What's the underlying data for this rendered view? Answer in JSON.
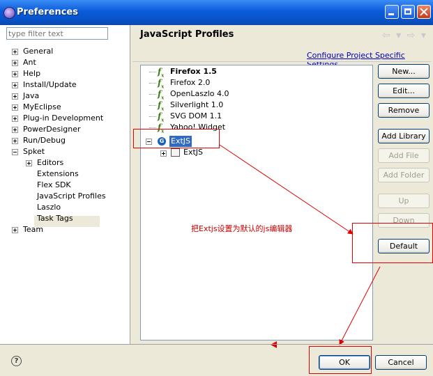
{
  "window": {
    "title": "Preferences"
  },
  "filter": {
    "placeholder": "type filter text"
  },
  "nav": {
    "items": [
      {
        "label": "General"
      },
      {
        "label": "Ant"
      },
      {
        "label": "Help"
      },
      {
        "label": "Install/Update"
      },
      {
        "label": "Java"
      },
      {
        "label": "MyEclipse"
      },
      {
        "label": "Plug-in Development"
      },
      {
        "label": "PowerDesigner"
      },
      {
        "label": "Run/Debug"
      },
      {
        "label": "Spket"
      },
      {
        "label": "Editors"
      },
      {
        "label": "Extensions"
      },
      {
        "label": "Flex SDK"
      },
      {
        "label": "JavaScript Profiles"
      },
      {
        "label": "Laszlo"
      },
      {
        "label": "Task Tags"
      },
      {
        "label": "Team"
      }
    ]
  },
  "page": {
    "title": "JavaScript Profiles",
    "config_link": "Configure Project Specific Settings..."
  },
  "profiles": [
    {
      "label": "Firefox 1.5"
    },
    {
      "label": "Firefox 2.0"
    },
    {
      "label": "OpenLaszlo 4.0"
    },
    {
      "label": "Silverlight 1.0"
    },
    {
      "label": "SVG DOM 1.1"
    },
    {
      "label": "Yahoo! Widget"
    },
    {
      "label": "ExtJS"
    },
    {
      "label": "ExtJS"
    }
  ],
  "buttons": {
    "new": "New...",
    "edit": "Edit...",
    "remove": "Remove",
    "add_library": "Add Library",
    "add_file": "Add File",
    "add_folder": "Add Folder",
    "up": "Up",
    "down": "Down",
    "default": "Default",
    "ok": "OK",
    "cancel": "Cancel"
  },
  "annotation": {
    "text": "把Extjs设置为默认的js编辑器"
  },
  "icons": {
    "help": "?",
    "nav_arrows": "⇦ ▾ ⇨ ▾"
  },
  "colors": {
    "titlebar": "#0a5bd9",
    "annotation": "#e00000",
    "link": "#0000c0"
  }
}
